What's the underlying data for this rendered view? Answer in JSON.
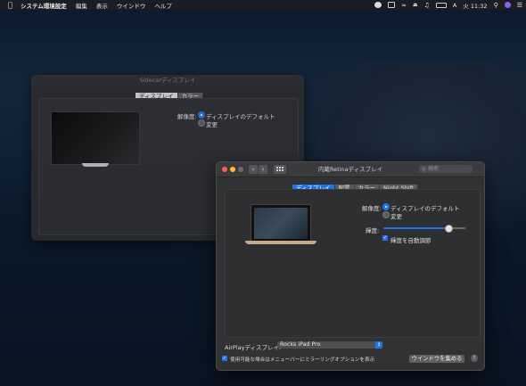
{
  "menubar": {
    "app_name": "システム環境設定",
    "items": [
      "編集",
      "表示",
      "ウインドウ",
      "ヘルプ"
    ],
    "clock": "火 11:32"
  },
  "sidecar_window": {
    "title": "Sidecarディスプレイ",
    "tabs": [
      "ディスプレイ",
      "カラー"
    ],
    "selected_tab": 0,
    "resolution_label": "解像度:",
    "option_default": "ディスプレイのデフォルト",
    "option_change": "変更"
  },
  "main_window": {
    "title": "内蔵Retinaディスプレイ",
    "search_placeholder": "検索",
    "tabs": [
      "ディスプレイ",
      "配置",
      "カラー",
      "Night Shift"
    ],
    "selected_tab": 0,
    "resolution_label": "解像度:",
    "option_default": "ディスプレイのデフォルト",
    "option_change": "変更",
    "brightness_label": "輝度:",
    "brightness_value": 0.78,
    "auto_brightness_label": "輝度を自動調節",
    "airplay_label": "AirPlayディスプレイ:",
    "airplay_value": "Rocks iPad Pro",
    "mirroring_option_label": "使用可能な場合はメニューバーにミラーリングオプションを表示",
    "gather_windows_button": "ウインドウを集める",
    "help_button": "?"
  },
  "colors": {
    "accent": "#1f74e8",
    "close": "#fe5f57",
    "minimize": "#febc2e",
    "zoom": "#28c840"
  }
}
